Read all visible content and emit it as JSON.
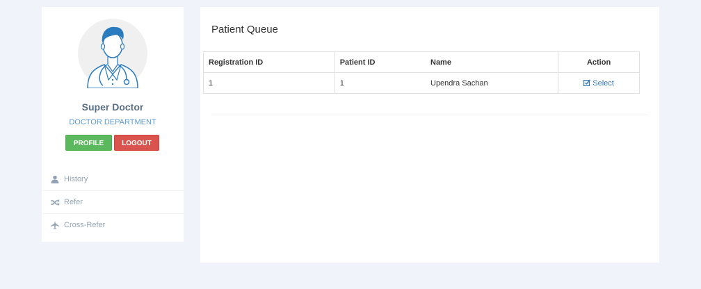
{
  "user": {
    "name": "Super Doctor",
    "department": "DOCTOR DEPARTMENT"
  },
  "buttons": {
    "profile": "PROFILE",
    "logout": "LOGOUT"
  },
  "nav": {
    "items": [
      {
        "label": "History",
        "icon": "user-icon"
      },
      {
        "label": "Refer",
        "icon": "shuffle-icon"
      },
      {
        "label": "Cross-Refer",
        "icon": "plane-icon"
      }
    ]
  },
  "main": {
    "title": "Patient Queue",
    "table": {
      "headers": [
        "Registration ID",
        "Patient ID",
        "Name",
        "Action"
      ],
      "rows": [
        {
          "registration_id": "1",
          "patient_id": "1",
          "name": "Upendra Sachan",
          "action": "Select"
        }
      ]
    }
  },
  "colors": {
    "background": "#f1f3fa",
    "profile_button": "#5cb85c",
    "logout_button": "#d9534f",
    "link": "#337ab7",
    "department": "#5b9bd1"
  }
}
